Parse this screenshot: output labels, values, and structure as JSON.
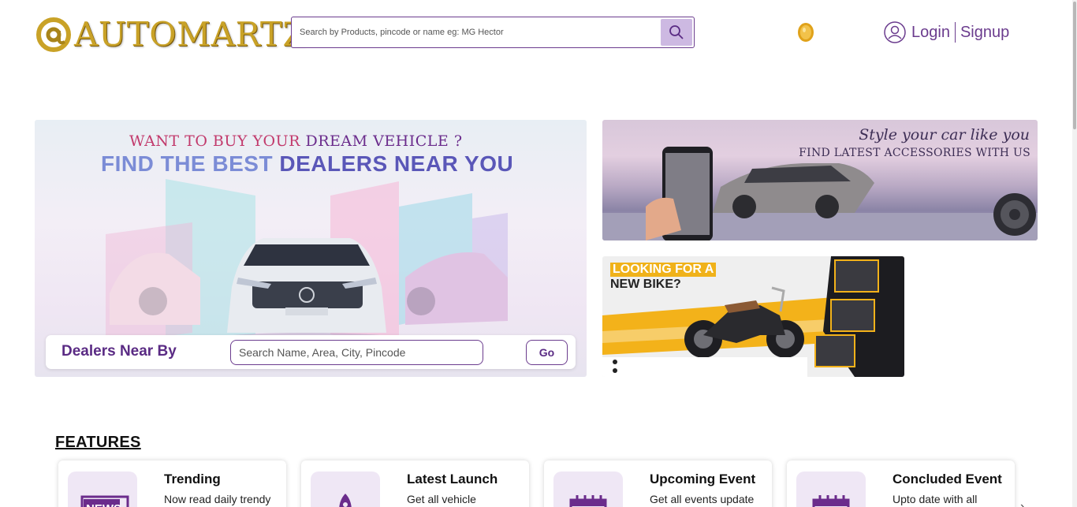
{
  "header": {
    "logo_text": "AUTOMARTZ",
    "search_placeholder": "Search by Products, pincode or name eg: MG Hector",
    "login_label": "Login",
    "signup_label": "Signup"
  },
  "hero": {
    "line1_a": "WANT TO BUY YOUR ",
    "line1_b": "DREAM VEHICLE ?",
    "line2_a": "FIND THE BEST ",
    "line2_b": "DEALERS NEAR YOU",
    "dealer_label": "Dealers Near By",
    "dealer_placeholder": "Search Name, Area, City, Pincode",
    "go_label": "Go"
  },
  "accessories": {
    "line1": "Style your car like you",
    "line2": "FIND LATEST ACCESSORIES WITH US"
  },
  "bike": {
    "line1": "LOOKING FOR A",
    "line2": "NEW BIKE?"
  },
  "features": {
    "title": "FEATURES",
    "cards": [
      {
        "title": "Trending",
        "desc": "Now read daily trendy",
        "icon": "news-icon"
      },
      {
        "title": "Latest Launch",
        "desc": "Get all vehicle",
        "icon": "rocket-icon"
      },
      {
        "title": "Upcoming Event",
        "desc": "Get all events update",
        "icon": "calendar-icon"
      },
      {
        "title": "Concluded Event",
        "desc": "Upto date with all",
        "icon": "calendar-check-icon"
      }
    ]
  },
  "colors": {
    "brand_purple": "#6b3c8e",
    "gold": "#c9a227",
    "icon_bg": "#efe7f5"
  }
}
